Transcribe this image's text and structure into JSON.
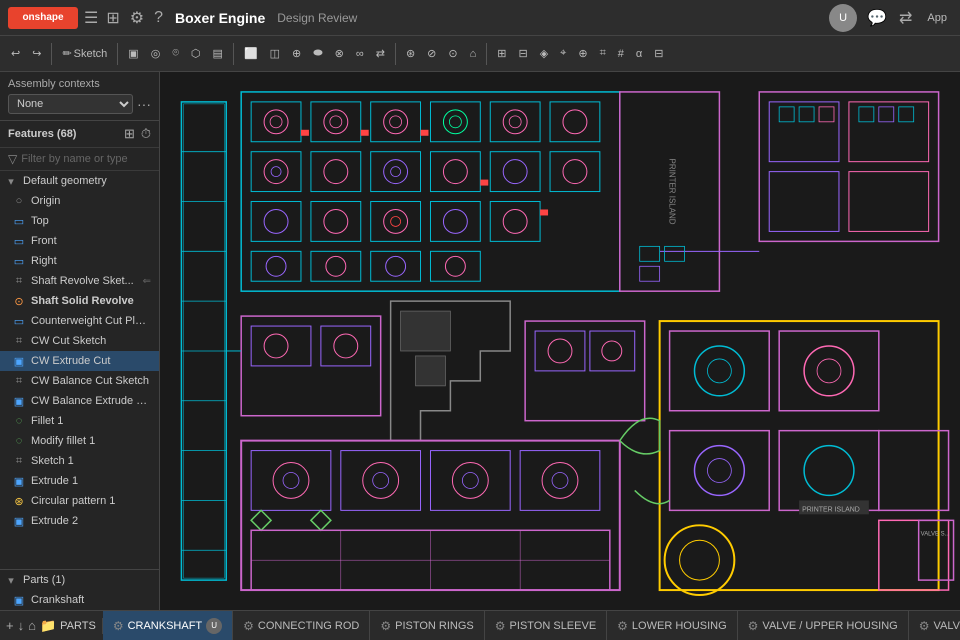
{
  "topbar": {
    "logo_text": "onshape",
    "hamburger": "☰",
    "grid_icon": "⊞",
    "doc_title": "Boxer Engine",
    "doc_subtitle": "Design Review",
    "app_label": "App"
  },
  "toolbar": {
    "sketch_label": "Sketch",
    "buttons": [
      {
        "id": "undo",
        "icon": "↩",
        "label": ""
      },
      {
        "id": "redo",
        "icon": "↪",
        "label": ""
      },
      {
        "id": "sketch",
        "icon": "✏",
        "label": "Sketch"
      },
      {
        "id": "tb1",
        "icon": "▣",
        "label": ""
      },
      {
        "id": "tb2",
        "icon": "◎",
        "label": ""
      },
      {
        "id": "tb3",
        "icon": "⌾",
        "label": ""
      },
      {
        "id": "tb4",
        "icon": "⬡",
        "label": ""
      },
      {
        "id": "tb5",
        "icon": "▤",
        "label": ""
      },
      {
        "id": "tb6",
        "icon": "⬜",
        "label": ""
      },
      {
        "id": "tb7",
        "icon": "◫",
        "label": ""
      },
      {
        "id": "tb8",
        "icon": "⊕",
        "label": ""
      },
      {
        "id": "tb9",
        "icon": "⬬",
        "label": ""
      },
      {
        "id": "tb10",
        "icon": "⊗",
        "label": ""
      },
      {
        "id": "tb11",
        "icon": "∞",
        "label": ""
      },
      {
        "id": "tb12",
        "icon": "⇄",
        "label": ""
      },
      {
        "id": "tb13",
        "icon": "⊛",
        "label": ""
      },
      {
        "id": "tb14",
        "icon": "⊘",
        "label": ""
      },
      {
        "id": "tb15",
        "icon": "⊙",
        "label": ""
      },
      {
        "id": "tb16",
        "icon": "⌂",
        "label": ""
      },
      {
        "id": "tb17",
        "icon": "⊞",
        "label": ""
      },
      {
        "id": "tb18",
        "icon": "⊟",
        "label": ""
      },
      {
        "id": "tb19",
        "icon": "◈",
        "label": ""
      },
      {
        "id": "tb20",
        "icon": "⌖",
        "label": ""
      },
      {
        "id": "tb21",
        "icon": "⊕",
        "label": ""
      },
      {
        "id": "tb22",
        "icon": "⌗",
        "label": ""
      }
    ]
  },
  "sidebar": {
    "assembly_contexts_label": "Assembly contexts",
    "assembly_none": "None",
    "features_title": "Features (68)",
    "filter_placeholder": "Filter by name or type",
    "features": [
      {
        "type": "group",
        "icon": "▾",
        "label": "Default geometry",
        "indent": 0
      },
      {
        "type": "item",
        "icon": "○",
        "icon_color": "normal",
        "label": "Origin",
        "indent": 1
      },
      {
        "type": "item",
        "icon": "▭",
        "icon_color": "blue",
        "label": "Top",
        "indent": 1
      },
      {
        "type": "item",
        "icon": "▭",
        "icon_color": "blue",
        "label": "Front",
        "indent": 1
      },
      {
        "type": "item",
        "icon": "▭",
        "icon_color": "blue",
        "label": "Right",
        "indent": 1
      },
      {
        "type": "item",
        "icon": "⌗",
        "icon_color": "normal",
        "label": "Shaft Revolve Sket...",
        "indent": 0,
        "extra": "⇐"
      },
      {
        "type": "item",
        "icon": "⊙",
        "icon_color": "orange",
        "label": "Shaft Solid Revolve",
        "indent": 0,
        "bold": true
      },
      {
        "type": "item",
        "icon": "▭",
        "icon_color": "blue",
        "label": "Counterweight Cut Plane",
        "indent": 0
      },
      {
        "type": "item",
        "icon": "⌗",
        "icon_color": "normal",
        "label": "CW Cut Sketch",
        "indent": 0
      },
      {
        "type": "item",
        "icon": "▣",
        "icon_color": "blue",
        "label": "CW Extrude Cut",
        "indent": 0,
        "selected": true
      },
      {
        "type": "item",
        "icon": "⌗",
        "icon_color": "normal",
        "label": "CW Balance Cut Sketch",
        "indent": 0
      },
      {
        "type": "item",
        "icon": "▣",
        "icon_color": "blue",
        "label": "CW Balance Extrude Cut",
        "indent": 0
      },
      {
        "type": "item",
        "icon": "◌",
        "icon_color": "green",
        "label": "Fillet 1",
        "indent": 0
      },
      {
        "type": "item",
        "icon": "◌",
        "icon_color": "green",
        "label": "Modify fillet 1",
        "indent": 0
      },
      {
        "type": "item",
        "icon": "⌗",
        "icon_color": "normal",
        "label": "Sketch 1",
        "indent": 0
      },
      {
        "type": "item",
        "icon": "▣",
        "icon_color": "blue",
        "label": "Extrude 1",
        "indent": 0
      },
      {
        "type": "item",
        "icon": "⊛",
        "icon_color": "yellow",
        "label": "Circular pattern 1",
        "indent": 0
      },
      {
        "type": "item",
        "icon": "▣",
        "icon_color": "blue",
        "label": "Extrude 2",
        "indent": 0
      }
    ],
    "parts_title": "Parts (1)",
    "parts": [
      {
        "label": "Crankshaft"
      }
    ]
  },
  "bottom_tabs": [
    {
      "id": "parts",
      "label": "PARTS",
      "icon": "▤",
      "active": false,
      "has_plus": false
    },
    {
      "id": "crankshaft",
      "label": "CRANKSHAFT",
      "icon": "⚙",
      "active": true,
      "has_avatar": true
    },
    {
      "id": "connecting-rod",
      "label": "CONNECTING ROD",
      "icon": "⚙",
      "active": false,
      "has_avatar": false
    },
    {
      "id": "piston-rings",
      "label": "PISTON RINGS",
      "icon": "⚙",
      "active": false,
      "has_avatar": false
    },
    {
      "id": "piston-sleeve",
      "label": "PISTON SLEEVE",
      "icon": "⚙",
      "active": false,
      "has_avatar": false
    },
    {
      "id": "lower-housing",
      "label": "LOWER HOUSING",
      "icon": "⚙",
      "active": false,
      "has_avatar": false
    },
    {
      "id": "valve-upper-housing",
      "label": "VALVE / UPPER HOUSING",
      "icon": "⚙",
      "active": false,
      "has_avatar": false
    },
    {
      "id": "valve-s",
      "label": "VALVE S...",
      "icon": "⚙",
      "active": false,
      "has_avatar": false
    }
  ],
  "colors": {
    "accent_blue": "#2a4a6a",
    "toolbar_bg": "#2d2d2d",
    "sidebar_bg": "#252525",
    "viewport_bg": "#1a1a1a"
  }
}
